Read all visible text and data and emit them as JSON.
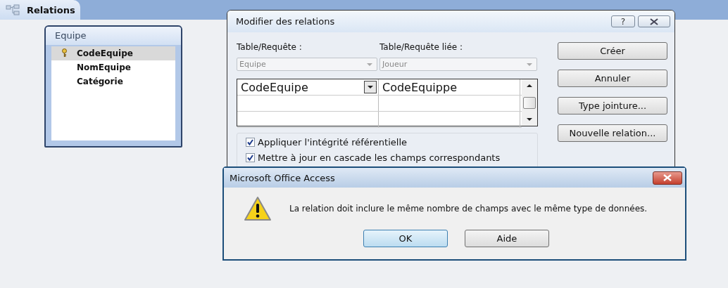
{
  "tab": {
    "label": "Relations",
    "selected": true
  },
  "table_window": {
    "title": "Equipe",
    "fields": [
      {
        "name": "CodeEquipe",
        "primary_key": true,
        "selected": true
      },
      {
        "name": "NomEquipe",
        "primary_key": false,
        "selected": false
      },
      {
        "name": "Catégorie",
        "primary_key": false,
        "selected": false
      }
    ]
  },
  "relations_dialog": {
    "title": "Modifier des relations",
    "help_button": "?",
    "table_label": "Table/Requête :",
    "related_table_label": "Table/Requête liée :",
    "table": {
      "value": "Equipe",
      "disabled": true
    },
    "related_table": {
      "value": "Joueur",
      "disabled": true
    },
    "field_rows": [
      {
        "field": "CodeEquipe",
        "related_field": "CodeEquippe"
      },
      {
        "field": "",
        "related_field": ""
      },
      {
        "field": "",
        "related_field": ""
      }
    ],
    "options": [
      {
        "label": "Appliquer l'intégrité référentielle",
        "checked": true
      },
      {
        "label": "Mettre à jour en cascade les champs correspondants",
        "checked": true
      }
    ],
    "buttons": [
      "Créer",
      "Annuler",
      "Type jointure...",
      "Nouvelle relation..."
    ]
  },
  "message_box": {
    "title": "Microsoft Office Access",
    "message": "La relation doit inclure le même nombre de champs avec le même type de données.",
    "buttons": [
      {
        "label": "OK",
        "selected": true
      },
      {
        "label": "Aide",
        "selected": false
      }
    ]
  }
}
